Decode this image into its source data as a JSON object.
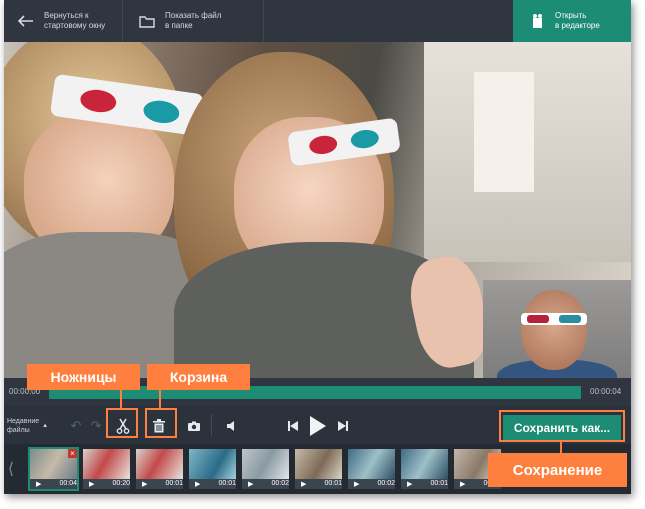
{
  "topbar": {
    "back_label": "Вернуться к\nстартовому окну",
    "show_file_label": "Показать файл\nв папке",
    "open_editor_label": "Открыть\nв редакторе"
  },
  "timeline": {
    "current_time": "00:00:00",
    "total_time": "00:00:04"
  },
  "controls": {
    "recent_files_label": "Недавние\nфайлы",
    "save_as_label": "Сохранить как..."
  },
  "filmstrip": [
    {
      "duration": "00:04",
      "selected": true
    },
    {
      "duration": "00:20"
    },
    {
      "duration": "00:01"
    },
    {
      "duration": "00:01"
    },
    {
      "duration": "00:02"
    },
    {
      "duration": "00:01"
    },
    {
      "duration": "00:02"
    },
    {
      "duration": "00:01"
    },
    {
      "duration": "00:02"
    }
  ],
  "callouts": {
    "scissors": "Ножницы",
    "trash": "Корзина",
    "save": "Сохранение"
  },
  "colors": {
    "accent": "#1c8c74",
    "callout": "#ff7f3f",
    "window_bg": "#2b323c"
  }
}
